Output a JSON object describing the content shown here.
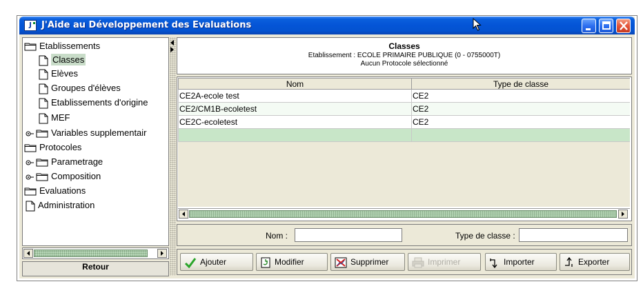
{
  "window": {
    "title": "J'Aide au Développement des Evaluations",
    "app_icon_text": "J"
  },
  "tree": {
    "items": [
      {
        "label": "Etablissements",
        "icon": "folder-icon"
      },
      {
        "label": "Classes",
        "icon": "document-icon",
        "selected": true
      },
      {
        "label": "Elèves",
        "icon": "document-icon"
      },
      {
        "label": "Groupes d'élèves",
        "icon": "document-icon"
      },
      {
        "label": "Etablissements d'origine",
        "icon": "document-icon"
      },
      {
        "label": "MEF",
        "icon": "document-icon"
      },
      {
        "label": "Variables supplementair",
        "icon": "folder-icon"
      },
      {
        "label": "Protocoles",
        "icon": "folder-icon"
      },
      {
        "label": "Parametrage",
        "icon": "folder-icon"
      },
      {
        "label": "Composition",
        "icon": "folder-icon"
      },
      {
        "label": "Evaluations",
        "icon": "folder-icon"
      },
      {
        "label": "Administration",
        "icon": "document-icon"
      }
    ],
    "retour_label": "Retour"
  },
  "header": {
    "title": "Classes",
    "etablissement": "Etablissement : ECOLE PRIMAIRE PUBLIQUE  (0 - 0755000T)",
    "protocole": "Aucun Protocole sélectionné"
  },
  "table": {
    "columns": [
      "Nom",
      "Type de classe"
    ],
    "rows": [
      [
        "CE2A-ecole test",
        "CE2"
      ],
      [
        "CE2/CM1B-ecoletest",
        "CE2"
      ],
      [
        "CE2C-ecoletest",
        "CE2"
      ],
      [
        "",
        ""
      ]
    ]
  },
  "form": {
    "nom_label": "Nom :",
    "nom_value": "",
    "type_label": "Type de classe :",
    "type_value": ""
  },
  "toolbar": {
    "ajouter": "Ajouter",
    "modifier": "Modifier",
    "supprimer": "Supprimer",
    "imprimer": "Imprimer",
    "importer": "Importer",
    "exporter": "Exporter"
  },
  "colors": {
    "titlebar": "#0454d6",
    "selection": "#c8dcc8",
    "active_row": "#c8e6c8",
    "check": "#2aa52a"
  }
}
